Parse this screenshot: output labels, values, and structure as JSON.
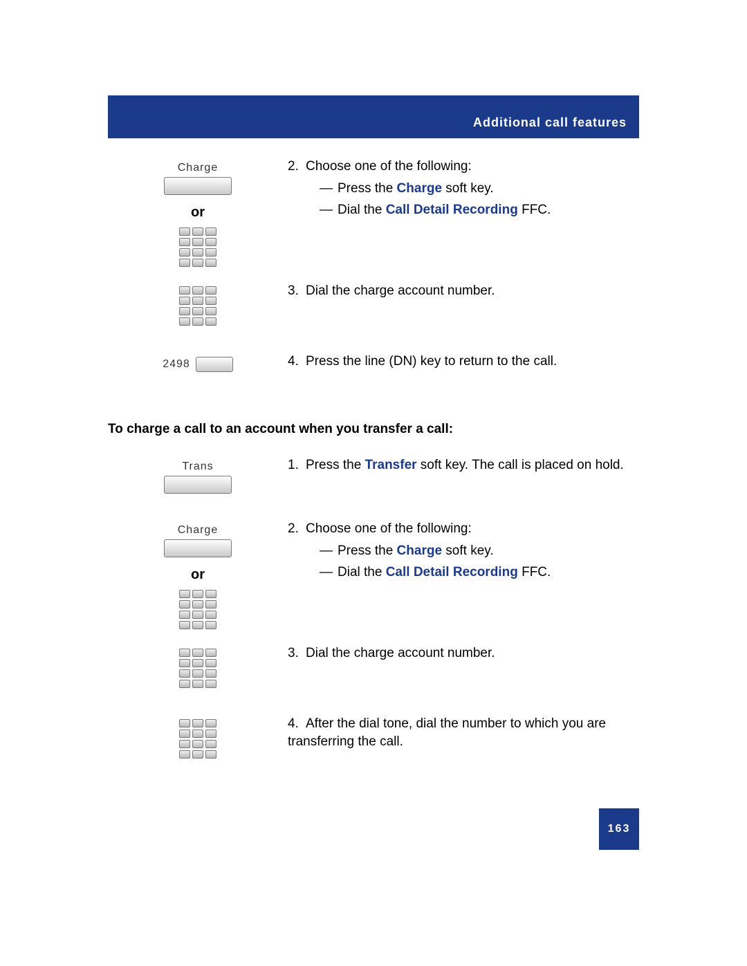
{
  "header": {
    "title": "Additional call features"
  },
  "labels": {
    "charge": "Charge",
    "trans": "Trans",
    "or": "or",
    "dn": "2498"
  },
  "section1": {
    "step2": {
      "num": "2.",
      "lead": "Choose one of the following:",
      "opt1_pre": "Press the ",
      "opt1_strong": "Charge",
      "opt1_post": " soft key.",
      "opt2_pre": "Dial the ",
      "opt2_strong": "Call Detail Recording",
      "opt2_post": " FFC."
    },
    "step3": {
      "num": "3.",
      "text": "Dial the charge account number."
    },
    "step4": {
      "num": "4.",
      "text": "Press the line (DN) key to return to the call."
    }
  },
  "heading": "To charge a call to an account when you transfer a call:",
  "section2": {
    "step1": {
      "num": "1.",
      "pre": "Press the ",
      "strong": "Transfer",
      "post": " soft key. The call is placed on hold."
    },
    "step2": {
      "num": "2.",
      "lead": "Choose one of the following:",
      "opt1_pre": "Press the ",
      "opt1_strong": "Charge",
      "opt1_post": " soft key.",
      "opt2_pre": "Dial the ",
      "opt2_strong": "Call Detail Recording",
      "opt2_post": " FFC."
    },
    "step3": {
      "num": "3.",
      "text": "Dial the charge account number."
    },
    "step4": {
      "num": "4.",
      "text": "After the dial tone, dial the number to which you are transferring the call."
    }
  },
  "footer": {
    "page": "163"
  }
}
